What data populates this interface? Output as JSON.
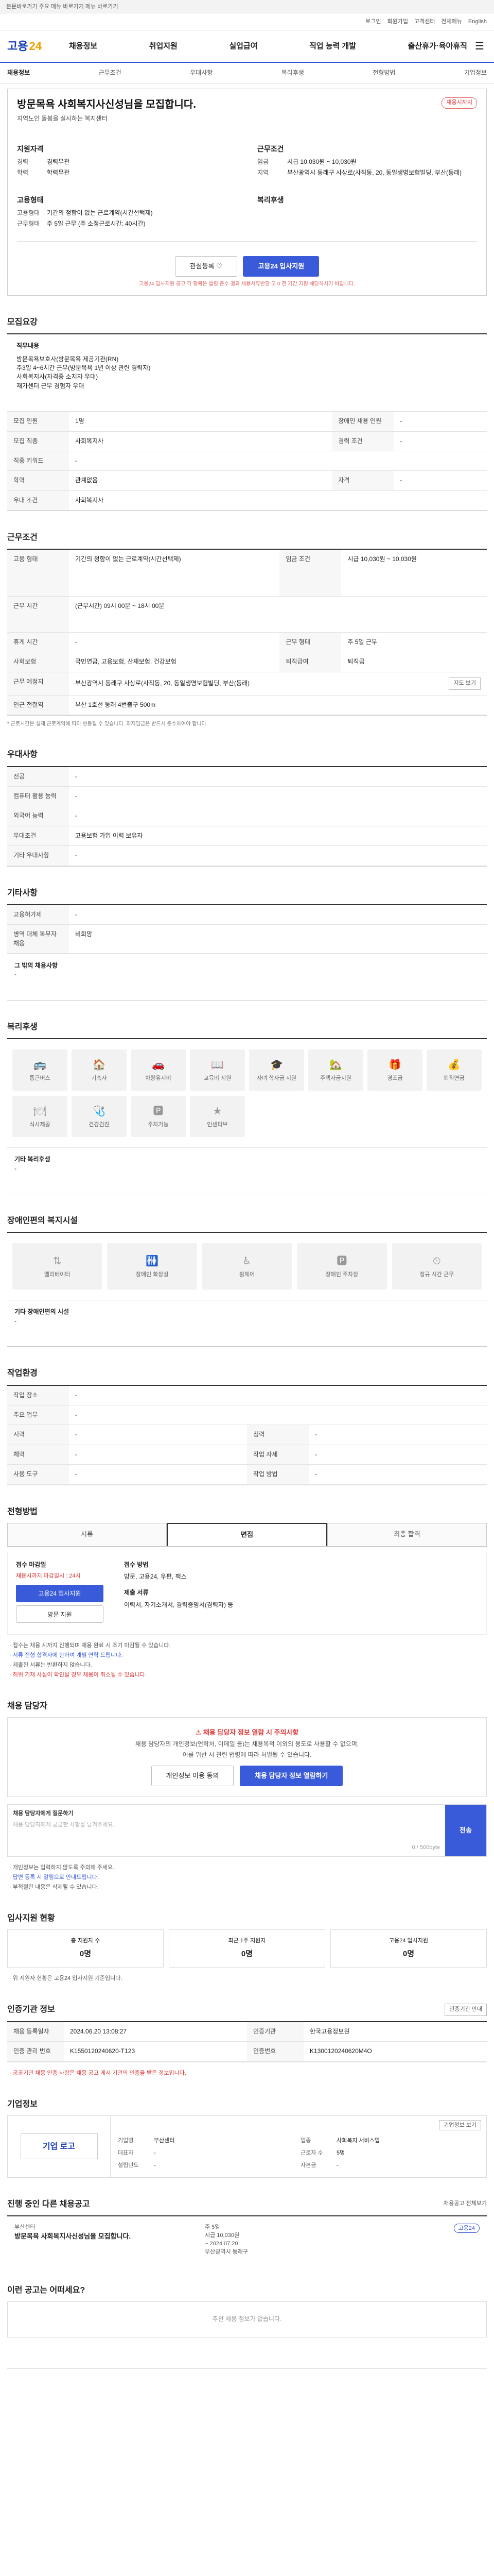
{
  "skip_link": "본문바로가기 주요 메뉴 바로가기 메뉴 바로가기",
  "top": {
    "links": [
      "로그인",
      "회원가입",
      "고객센터",
      "전체메뉴",
      "English"
    ]
  },
  "gnb": {
    "logo_text": "고용",
    "logo_num": "24",
    "menu": [
      "채용정보",
      "취업지원",
      "실업급여",
      "직업 능력 개발",
      "출산휴가·육아휴직"
    ]
  },
  "lnb": [
    "채용정보",
    "근무조건",
    "우대사항",
    "복리후생",
    "전형방법",
    "기업정보"
  ],
  "job": {
    "title": "방문목욕 사회복지사신성님을 모집합니다.",
    "badge": "채용시까지",
    "company": "지역노인 돌봄을 실시하는 복지센터",
    "left_head": "지원자격",
    "left": [
      [
        "경력",
        "경력무관"
      ],
      [
        "학력",
        "학력무관"
      ]
    ],
    "left2_head": "고용형태",
    "left2": [
      [
        "고용형태",
        "기간의 정함이 없는 근로계약(시간선택제)"
      ],
      [
        "근무형태",
        "주 5일 근무 (주 소정근로시간: 40시간)"
      ]
    ],
    "right_head": "근무조건",
    "right": [
      [
        "임금",
        "시급 10,030원 ~ 10,030원"
      ],
      [
        "지역",
        "부산광역시 동래구 사상로(사직동, 20, 동일생명보험빌딩, 부산(동래)"
      ]
    ],
    "right2_head": "복리후생",
    "right2": [
      [
        "",
        ""
      ]
    ],
    "interest_btn": "관심등록 ♡",
    "apply_btn": "고용24 입사지원",
    "notice": "고용24 입사지원 공고 각 항목은 법령 준수 결과 채용서류반환 고 0 전 기간 지원 해당하시기 바랍니다."
  },
  "recruit": {
    "heading": "모집요강",
    "job_title": "직무내용",
    "desc_lines": [
      "방문목욕보호사(방문목욕 제공기관(RN)",
      "주3일 4~6시간 근무(방문목욕 1년 이상 관련 경력자)",
      "사회복지사(자격증 소지자 우대)",
      "재가센터 근무 경험자 우대"
    ],
    "rows": [
      [
        "모집 인원",
        "1명",
        "장애인 채용 인원",
        "-"
      ],
      [
        "모집 직종",
        "사회복지사",
        "경력 조건",
        "-"
      ],
      [
        "직종 키워드",
        "-",
        "",
        ""
      ],
      [
        "학력",
        "관계없음",
        "자격",
        "-"
      ],
      [
        "우대 조건",
        "사회복지사",
        "",
        ""
      ]
    ]
  },
  "work": {
    "heading": "근무조건",
    "rows": [
      [
        "고용 형태",
        "기간의 정함이 없는 근로계약(시간선택제)",
        "임금 조건",
        "시급 10,030원 ~ 10,030원"
      ],
      [
        "근무 시간",
        "(근무시간) 09시 00분 ~ 18시 00분",
        "",
        ""
      ],
      [
        "휴게 시간",
        "-",
        "근무 형태",
        "주 5일 근무"
      ],
      [
        "사회보험",
        "국민연금, 고용보험, 산재보험, 건강보험",
        "퇴직급여",
        "퇴직금"
      ],
      [
        "근무 예정지",
        "부산광역시 동래구 사상로(사직동, 20, 동일생명보험빌딩, 부산(동래)",
        "",
        ""
      ],
      [
        "인근 전철역",
        "부산 1호선 동래 4번출구 500m",
        "",
        ""
      ]
    ],
    "footnote": "* 근로시간은 실제 근로계약에 따라 변동될 수 있습니다. 최저임금은 반드시 준수하여야 합니다.",
    "map_btn": "지도 보기"
  },
  "pref": {
    "heading": "우대사항",
    "rows": [
      [
        "전공",
        "-"
      ],
      [
        "컴퓨터 활용 능력",
        "-"
      ],
      [
        "외국어 능력",
        "-"
      ],
      [
        "우대조건",
        "고용보험 가입 이력 보유자"
      ],
      [
        "기타 우대사항",
        "-"
      ]
    ]
  },
  "other_info": {
    "heading": "기타사항",
    "rows": [
      [
        "고용허가제",
        "-"
      ],
      [
        "병역 대체 복무자 채용",
        "비희망"
      ]
    ],
    "etc_head": "그 밖의 채용사항",
    "etc": "-"
  },
  "welfare": {
    "heading": "복리후생",
    "items": [
      "통근버스",
      "기숙사",
      "차량유지비",
      "교육비 지원",
      "자녀 학자금 지원",
      "주택자금지원",
      "경조금",
      "퇴직연금",
      "식사제공",
      "건강검진",
      "주차가능",
      "인센티브"
    ],
    "etc_head": "기타 복리후생",
    "etc": "-"
  },
  "disabled": {
    "heading": "장애인편의 복지시설",
    "items": [
      "엘리베이터",
      "장애인 화장실",
      "휠체어",
      "장애인 주차장",
      "정규 시간 근무"
    ],
    "etc_head": "기타 장애인편의 시설",
    "etc": "-"
  },
  "workenv": {
    "heading": "작업환경",
    "rows": [
      [
        "작업 장소",
        "-",
        "",
        ""
      ],
      [
        "주요 업무",
        "-",
        "",
        ""
      ],
      [
        "시력",
        "-",
        "청력",
        "-"
      ],
      [
        "체력",
        "-",
        "작업 자세",
        "-"
      ],
      [
        "사용 도구",
        "-",
        "작업 방법",
        "-"
      ]
    ]
  },
  "select": {
    "heading": "전형방법",
    "tabs": [
      "서류",
      "면접",
      "최종 합격"
    ],
    "apply_head": "접수 마감일",
    "deadline": "채용시까지 마감일시 : 24시",
    "apply_btn": "고용24 입사지원",
    "visit_btn": "방문 지원",
    "methods_head": "접수 방법",
    "methods": "방문, 고용24, 우편, 팩스",
    "docs_head": "제출 서류",
    "docs": "이력서, 자기소개서, 경력증명서(경력자) 등",
    "bullets": [
      "· 접수는 채용 시까지 진행되며 채용 완료 시 조기 마감될 수 있습니다.",
      "· 서류 전형 합격자에 한하여 개별 연락 드립니다.",
      "· 제출된 서류는 반환하지 않습니다.",
      "· 허위 기재 사실이 확인될 경우 채용이 취소될 수 있습니다."
    ]
  },
  "contact": {
    "heading": "채용 담당자",
    "warn": "채용 담당자 정보 열람 시 주의사항",
    "lines": [
      "채용 담당자의 개인정보(연락처, 이메일 등)는 채용목적 이외의 용도로 사용할 수 없으며,",
      "이를 위반 시 관련 법령에 따라 처벌될 수 있습니다."
    ],
    "btn1": "개인정보 이용 동의",
    "btn2": "채용 담당자 정보 열람하기",
    "q_head": "채용 담당자에게 질문하기",
    "q_placeholder": "채용 담당자에게 궁금한 사항을 남겨주세요.",
    "q_count": "0 / 500byte",
    "q_submit": "전송",
    "q_notes": [
      "· 개인정보는 입력하지 않도록 주의해 주세요.",
      "· 답변 등록 시 알림으로 안내드립니다.",
      "· 부적절한 내용은 삭제될 수 있습니다."
    ]
  },
  "status": {
    "heading": "입사지원 현황",
    "cards": [
      [
        "총 지원자 수",
        "0명"
      ],
      [
        "최근 1주 지원자",
        "0명"
      ],
      [
        "고용24 입사지원",
        "0명"
      ]
    ],
    "note": "· 위 지원자 현황은 고용24 입사지원 기준입니다."
  },
  "cert": {
    "heading": "인증기관 정보",
    "btn": "인증기관 안내",
    "rows": [
      [
        "채용 등록일자",
        "2024.06.20 13:08:27",
        "인증기관",
        "한국고용정보원"
      ],
      [
        "인증 관리 번호",
        "K1550120240620-T123",
        "인증번호",
        "K1300120240620M4O"
      ]
    ],
    "note": "· 공공기관 채용 인증 사항은 채용 공고 게시 기관의 인증을 받은 정보입니다."
  },
  "company": {
    "heading": "기업정보",
    "logo": "기업 로고",
    "btn": "기업정보 보기",
    "info": [
      [
        "기업명",
        "부산센터",
        "업종",
        "사회복지 서비스업"
      ],
      [
        "대표자",
        "-",
        "근로자 수",
        "5명"
      ],
      [
        "설립년도",
        "-",
        "자본금",
        "-"
      ]
    ]
  },
  "others": {
    "heading": "진행 중인 다른 채용공고",
    "link": "채용공고 전체보기",
    "title": "방문목욕 사회복지사신성님을 모집합니다.",
    "company": "부산센터",
    "info": [
      "주 5일",
      "시급 10,030원",
      "~ 2024.07.20",
      "부산광역시 동래구"
    ],
    "badge": "고용24"
  },
  "reco": {
    "heading": "이런 공고는 어떠세요?",
    "empty": "추천 채용 정보가 없습니다."
  }
}
